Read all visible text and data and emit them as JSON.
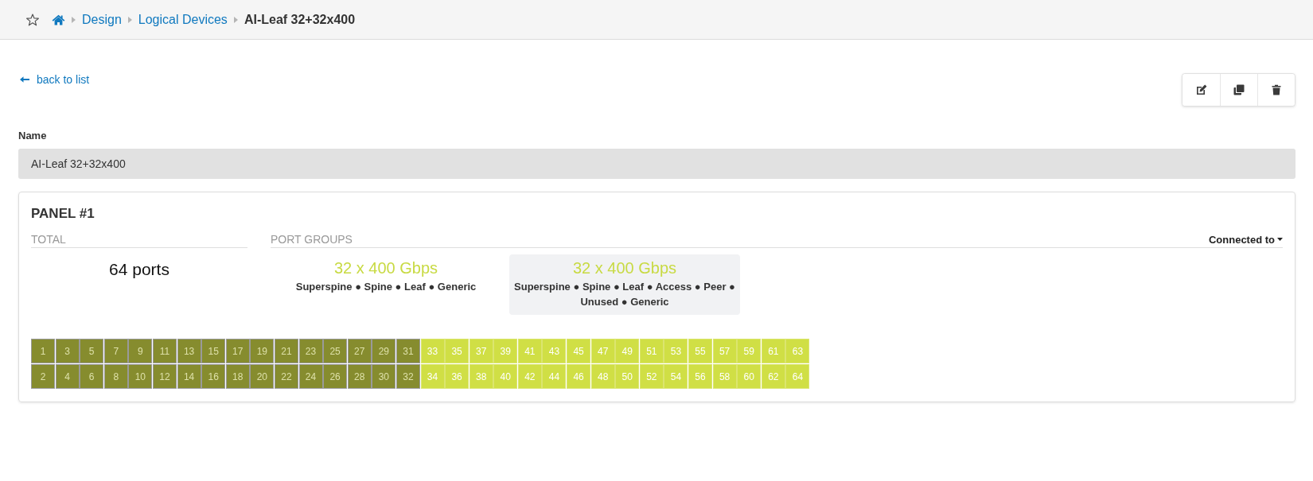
{
  "breadcrumb": {
    "items": [
      {
        "label": "Design",
        "kind": "link"
      },
      {
        "label": "Logical Devices",
        "kind": "link"
      },
      {
        "label": "AI-Leaf 32+32x400",
        "kind": "current"
      }
    ]
  },
  "back_link": "back to list",
  "toolbar": {
    "buttons": [
      {
        "kind": "edit"
      },
      {
        "kind": "clone"
      },
      {
        "kind": "delete"
      }
    ]
  },
  "name_field": {
    "label": "Name",
    "value": "AI-Leaf 32+32x400"
  },
  "panel": {
    "title": "PANEL #1",
    "total": {
      "heading": "TOTAL",
      "value": "64 ports"
    },
    "port_groups": {
      "heading": "PORT GROUPS",
      "filter": "Connected to",
      "groups": [
        {
          "speed": "32 x 400 Gbps",
          "roles": "Superspine ● Spine ● Leaf ● Generic",
          "selected": false
        },
        {
          "speed": "32 x 400 Gbps",
          "roles": "Superspine ● Spine ● Leaf ● Access ● Peer ● Unused ● Generic",
          "selected": true
        }
      ]
    },
    "ports": [
      {
        "label": "1",
        "selected": true
      },
      {
        "label": "2",
        "selected": true
      },
      {
        "label": "3",
        "selected": true
      },
      {
        "label": "4",
        "selected": true
      },
      {
        "label": "5",
        "selected": true
      },
      {
        "label": "6",
        "selected": true
      },
      {
        "label": "7",
        "selected": true
      },
      {
        "label": "8",
        "selected": true
      },
      {
        "label": "9",
        "selected": true
      },
      {
        "label": "10",
        "selected": true
      },
      {
        "label": "11",
        "selected": true
      },
      {
        "label": "12",
        "selected": true
      },
      {
        "label": "13",
        "selected": true
      },
      {
        "label": "14",
        "selected": true
      },
      {
        "label": "15",
        "selected": true
      },
      {
        "label": "16",
        "selected": true
      },
      {
        "label": "17",
        "selected": true
      },
      {
        "label": "18",
        "selected": true
      },
      {
        "label": "19",
        "selected": true
      },
      {
        "label": "20",
        "selected": true
      },
      {
        "label": "21",
        "selected": true
      },
      {
        "label": "22",
        "selected": true
      },
      {
        "label": "23",
        "selected": true
      },
      {
        "label": "24",
        "selected": true
      },
      {
        "label": "25",
        "selected": true
      },
      {
        "label": "26",
        "selected": true
      },
      {
        "label": "27",
        "selected": true
      },
      {
        "label": "28",
        "selected": true
      },
      {
        "label": "29",
        "selected": true
      },
      {
        "label": "30",
        "selected": true
      },
      {
        "label": "31",
        "selected": true
      },
      {
        "label": "32",
        "selected": true
      },
      {
        "label": "33",
        "selected": false
      },
      {
        "label": "34",
        "selected": false
      },
      {
        "label": "35",
        "selected": false
      },
      {
        "label": "36",
        "selected": false
      },
      {
        "label": "37",
        "selected": false
      },
      {
        "label": "38",
        "selected": false
      },
      {
        "label": "39",
        "selected": false
      },
      {
        "label": "40",
        "selected": false
      },
      {
        "label": "41",
        "selected": false
      },
      {
        "label": "42",
        "selected": false
      },
      {
        "label": "43",
        "selected": false
      },
      {
        "label": "44",
        "selected": false
      },
      {
        "label": "45",
        "selected": false
      },
      {
        "label": "46",
        "selected": false
      },
      {
        "label": "47",
        "selected": false
      },
      {
        "label": "48",
        "selected": false
      },
      {
        "label": "49",
        "selected": false
      },
      {
        "label": "50",
        "selected": false
      },
      {
        "label": "51",
        "selected": false
      },
      {
        "label": "52",
        "selected": false
      },
      {
        "label": "53",
        "selected": false
      },
      {
        "label": "54",
        "selected": false
      },
      {
        "label": "55",
        "selected": false
      },
      {
        "label": "56",
        "selected": false
      },
      {
        "label": "57",
        "selected": false
      },
      {
        "label": "58",
        "selected": false
      },
      {
        "label": "59",
        "selected": false
      },
      {
        "label": "60",
        "selected": false
      },
      {
        "label": "61",
        "selected": false
      },
      {
        "label": "62",
        "selected": false
      },
      {
        "label": "63",
        "selected": false
      },
      {
        "label": "64",
        "selected": false
      }
    ]
  }
}
